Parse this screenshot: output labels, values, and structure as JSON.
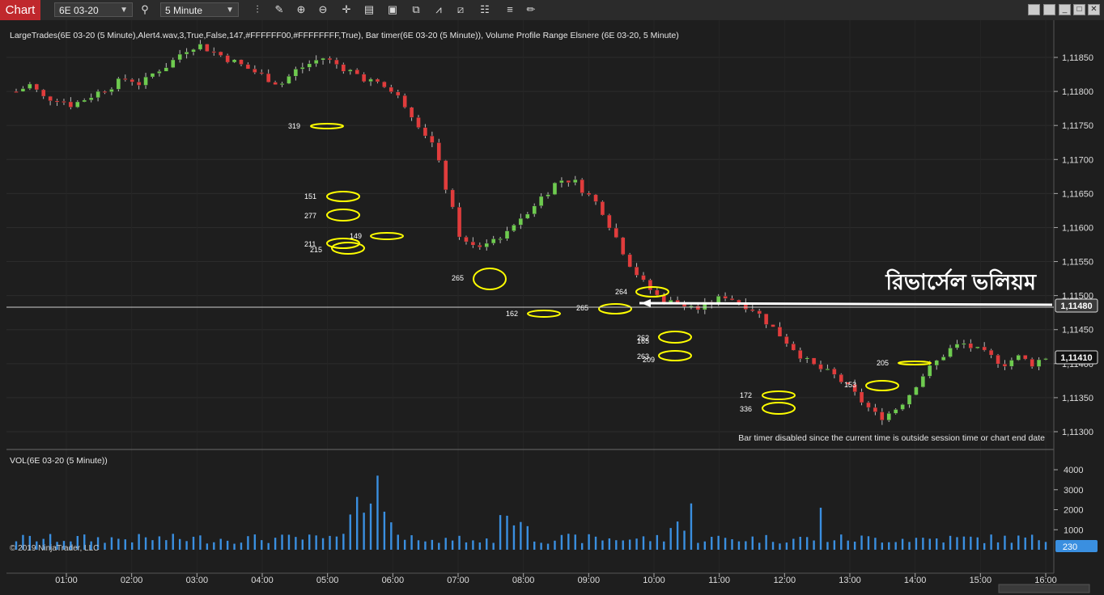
{
  "toolbar": {
    "tab_label": "Chart",
    "instrument": "6E 03-20",
    "interval": "5 Minute"
  },
  "header_text": "LargeTrades(6E 03-20 (5 Minute),Alert4.wav,3,True,False,147,#FFFFFF00,#FFFFFFFF,True), Bar timer(6E 03-20 (5 Minute)), Volume Profile Range Elsnere (6E 03-20, 5 Minute)",
  "bar_timer_note": "Bar timer disabled since the current time is outside session time or chart end date",
  "annotation_text": "রিভার্সেল ভলিয়ম",
  "copyright": "© 2019 NinjaTrader, LLC",
  "volume_label": "VOL(6E 03-20 (5 Minute))",
  "colors": {
    "background": "#1e1e1e",
    "up": "#6ecb4f",
    "down": "#e03c3c",
    "volume": "#3a8fe0",
    "highlight": "#ffff00"
  },
  "chart_data": {
    "type": "candlestick",
    "price_axis": {
      "ticks": [
        1.1185,
        1.118,
        1.1175,
        1.117,
        1.1165,
        1.116,
        1.1155,
        1.115,
        1.1145,
        1.114,
        1.1135,
        1.113
      ],
      "tick_labels": [
        "1,11850",
        "1,11800",
        "1,11750",
        "1,11700",
        "1,11650",
        "1,11600",
        "1,11550",
        "1,11500",
        "1,11450",
        "1,11400",
        "1,11350",
        "1,11300"
      ]
    },
    "time_axis": {
      "tick_labels": [
        "01:00",
        "02:00",
        "03:00",
        "04:00",
        "05:00",
        "06:00",
        "07:00",
        "08:00",
        "09:00",
        "10:00",
        "11:00",
        "12:00",
        "13:00",
        "14:00",
        "15:00",
        "16:00"
      ]
    },
    "volume_axis": {
      "tick_labels": [
        "4000",
        "3000",
        "2000",
        "1000"
      ]
    },
    "price_markers": [
      {
        "label": "1,11480",
        "value": 1.1148
      },
      {
        "label": "1,11410",
        "value": 1.1141
      }
    ],
    "volume_marker": {
      "label": "230",
      "value": 230
    },
    "large_trade_labels": [
      "319",
      "151",
      "277",
      "211",
      "215",
      "149",
      "265",
      "162",
      "265",
      "264",
      "262",
      "165",
      "263",
      "209",
      "172",
      "336",
      "153",
      "205"
    ],
    "close_path": [
      1.118,
      1.1181,
      1.1179,
      1.1179,
      1.1178,
      1.1179,
      1.118,
      1.1181,
      1.1182,
      1.1181,
      1.1183,
      1.1184,
      1.1186,
      1.1187,
      1.1186,
      1.1185,
      1.1184,
      1.1183,
      1.1182,
      1.1181,
      1.1183,
      1.1184,
      1.1185,
      1.1184,
      1.1183,
      1.1182,
      1.1181,
      1.118,
      1.1178,
      1.1175,
      1.1172,
      1.1165,
      1.1158,
      1.1157,
      1.1158,
      1.1159,
      1.1161,
      1.1163,
      1.1165,
      1.1167,
      1.1167,
      1.1165,
      1.1163,
      1.1159,
      1.1155,
      1.1152,
      1.115,
      1.1149,
      1.1149,
      1.1148,
      1.1149,
      1.115,
      1.1149,
      1.1148,
      1.1146,
      1.1144,
      1.1142,
      1.114,
      1.1139,
      1.1138,
      1.1136,
      1.1134,
      1.1132,
      1.1133,
      1.1135,
      1.1138,
      1.114,
      1.1142,
      1.1143,
      1.1142,
      1.1141,
      1.114,
      1.1141,
      1.114,
      1.1141
    ]
  }
}
